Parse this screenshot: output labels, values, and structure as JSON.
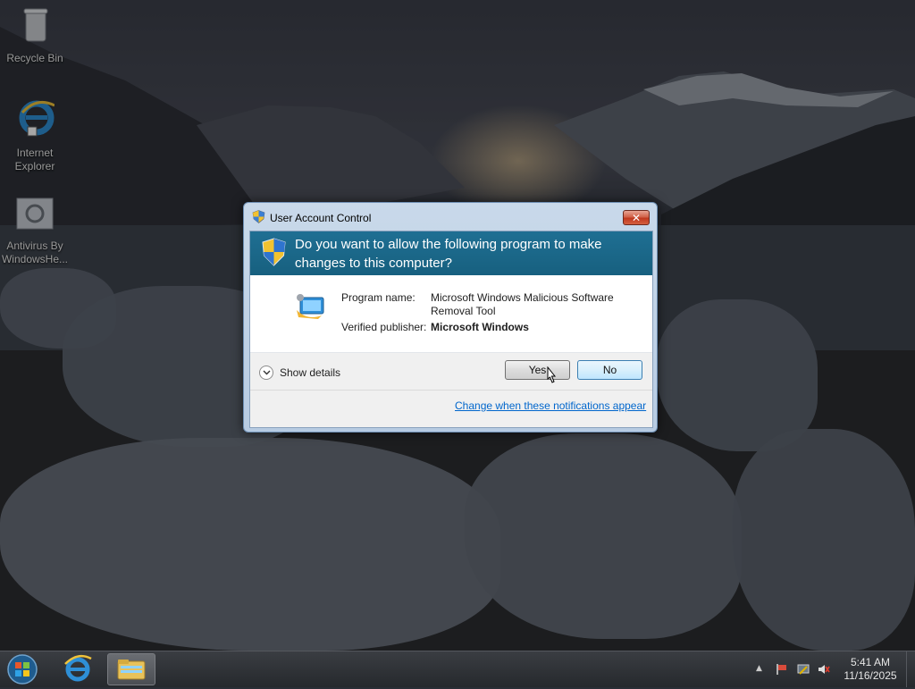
{
  "desktop": {
    "icons": [
      {
        "label": "Recycle Bin"
      },
      {
        "label": "Internet Explorer"
      },
      {
        "label": "Antivirus By WindowsHe..."
      }
    ]
  },
  "uac": {
    "title": "User Account Control",
    "question": "Do you want to allow the following program to make changes to this computer?",
    "program_name_label": "Program name:",
    "program_name_value": "Microsoft Windows Malicious Software Removal Tool",
    "publisher_label": "Verified publisher:",
    "publisher_value": "Microsoft Windows",
    "show_details": "Show details",
    "yes_label": "Yes",
    "no_label": "No",
    "change_link": "Change when these notifications appear",
    "close_glyph": "✕"
  },
  "taskbar": {
    "time": "5:41 AM",
    "date": "11/16/2025",
    "tray_expand_glyph": "▲"
  },
  "colors": {
    "uac_header": "#1f6f93",
    "link": "#0066cc"
  }
}
